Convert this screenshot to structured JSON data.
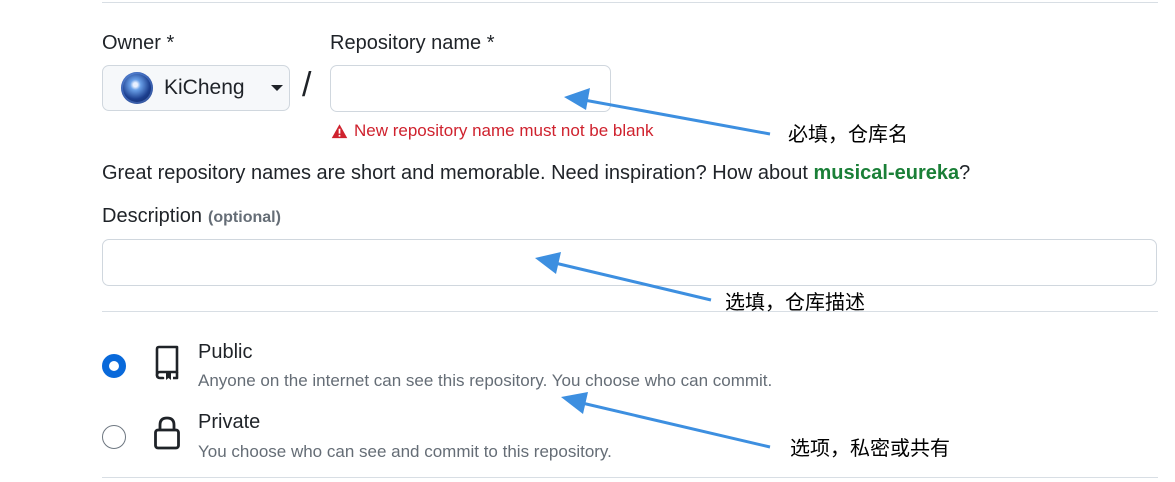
{
  "owner": {
    "label": "Owner *",
    "name": "KiCheng"
  },
  "repository": {
    "label": "Repository name *",
    "value": "",
    "separator": "/",
    "error": "New repository name must not be blank"
  },
  "hint": {
    "text": "Great repository names are short and memorable. Need inspiration? How about ",
    "suggestion": "musical-eureka",
    "suffix": "?"
  },
  "description": {
    "label": "Description",
    "optional": "(optional)",
    "value": ""
  },
  "visibility": {
    "selected": "public",
    "public": {
      "title": "Public",
      "desc": "Anyone on the internet can see this repository. You choose who can commit.",
      "icon": "repo-book-icon"
    },
    "private": {
      "title": "Private",
      "desc": "You choose who can see and commit to this repository.",
      "icon": "lock-icon"
    }
  },
  "annotations": {
    "repo_name_note": "必填，仓库名",
    "description_note": "选填，仓库描述",
    "visibility_note": "选项，私密或共有",
    "arrow_color": "#3d8fe0"
  },
  "colors": {
    "error": "#cf222e",
    "suggestion": "#1a7f37",
    "radio_selected": "#0969da"
  }
}
